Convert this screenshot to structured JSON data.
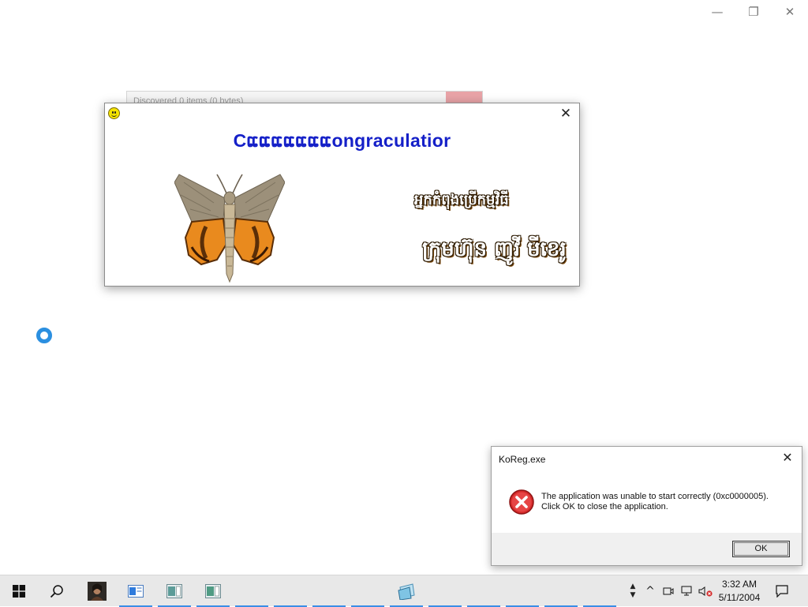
{
  "window_controls": {
    "minimize": "—",
    "restore": "❐",
    "close": "✕"
  },
  "background_window": {
    "title": "Discovered 0 items (0 bytes)"
  },
  "congrats_dialog": {
    "close_glyph": "✕",
    "headline": "Cແແແແແແແongraculatior",
    "khmer_line_1": "អ្នកកំពុងប្រើកម្មវិធី",
    "khmer_line_2": "ក្រុមហ៊ុន ញូវី មីខេរូ"
  },
  "error_dialog": {
    "title": "KoReg.exe",
    "close_glyph": "✕",
    "message_line_1": "The application was unable to start correctly (0xc0000005).",
    "message_line_2": "Click OK to close the application.",
    "ok_label": "OK"
  },
  "taskbar": {
    "clock_time": "3:32 AM",
    "clock_date": "5/11/2004",
    "tray_up_arrow": "^",
    "notification_glyph": "💬"
  },
  "colors": {
    "headline_blue": "#1520c8",
    "taskbar_bg": "#e8e8e8",
    "active_indicator": "#3a8ee6",
    "error_red": "#d42a2a"
  },
  "icons": {
    "start": "windows-logo-icon",
    "search": "search-icon",
    "tray": [
      "chevron-up-icon",
      "meet-now-icon",
      "network-icon",
      "volume-muted-icon"
    ],
    "notifications": "action-center-icon"
  }
}
